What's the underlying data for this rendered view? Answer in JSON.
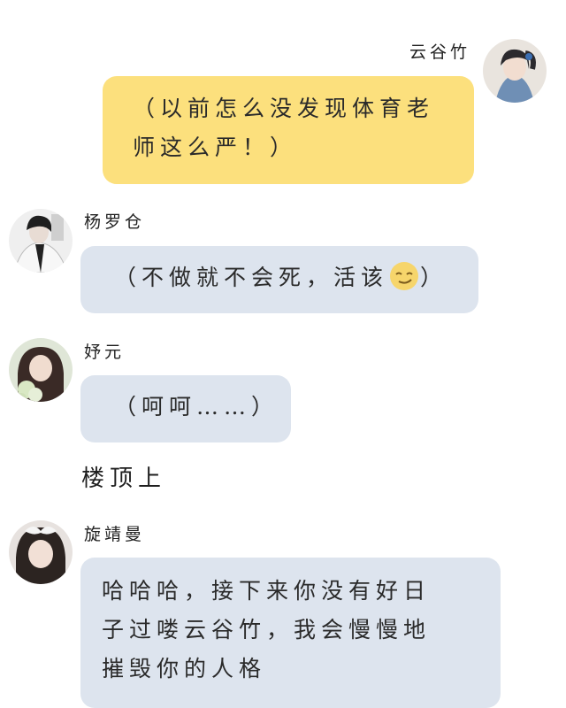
{
  "messages": [
    {
      "sender": "云谷竹",
      "side": "right",
      "text_lines": [
        "（以前怎么没发现体育老",
        "师这么严！）"
      ]
    },
    {
      "sender": "杨罗仓",
      "side": "left",
      "text_before": "（不做就不会死，活该",
      "emoji": "smirk-emoji",
      "text_after": "）"
    },
    {
      "sender": "妤元",
      "side": "left",
      "text": "（呵呵……）"
    },
    {
      "scene_note": "楼顶上"
    },
    {
      "sender": "旋靖曼",
      "side": "left",
      "text_lines": [
        "哈哈哈，接下来你没有好日",
        "子过喽云谷竹，我会慢慢地",
        "摧毁你的人格"
      ]
    }
  ],
  "colors": {
    "self_bubble": "#fce07d",
    "other_bubble": "#dde4ee",
    "background": "#ffffff"
  }
}
